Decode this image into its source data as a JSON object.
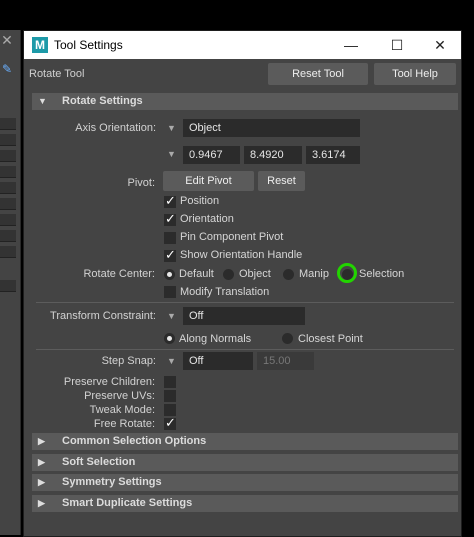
{
  "window": {
    "title": "Tool Settings",
    "app_icon_letter": "M",
    "min_glyph": "—",
    "max_glyph": "☐",
    "close_glyph": "✕"
  },
  "left_strip": {
    "close_glyph": "✕",
    "edit_glyph": "✎"
  },
  "toolbar": {
    "tool_name": "Rotate Tool",
    "reset_tool_label": "Reset Tool",
    "tool_help_label": "Tool Help"
  },
  "rotate_settings": {
    "header": "Rotate Settings",
    "axis_orientation": {
      "label": "Axis Orientation:",
      "value": "Object"
    },
    "axis_values": [
      "0.9467",
      "8.4920",
      "3.6174"
    ],
    "pivot": {
      "label": "Pivot:",
      "edit_label": "Edit Pivot",
      "reset_label": "Reset"
    },
    "checkboxes": [
      {
        "label": "Position",
        "checked": true
      },
      {
        "label": "Orientation",
        "checked": true
      },
      {
        "label": "Pin Component Pivot",
        "checked": false
      },
      {
        "label": "Show Orientation Handle",
        "checked": true
      }
    ],
    "rotate_center": {
      "label": "Rotate Center:",
      "options": [
        "Default",
        "Object",
        "Manip",
        "Selection"
      ],
      "selected": "Default"
    },
    "modify_translation": {
      "label": "Modify Translation",
      "checked": false
    },
    "transform_constraint": {
      "label": "Transform Constraint:",
      "value": "Off"
    },
    "constraint_options": {
      "along_normals": "Along Normals",
      "closest_point": "Closest Point",
      "selected": "Along Normals"
    },
    "step_snap": {
      "label": "Step Snap:",
      "value": "Off",
      "amount": "15.00"
    },
    "flags": [
      {
        "label": "Preserve Children:",
        "checked": false
      },
      {
        "label": "Preserve UVs:",
        "checked": false
      },
      {
        "label": "Tweak Mode:",
        "checked": false
      },
      {
        "label": "Free Rotate:",
        "checked": true
      }
    ]
  },
  "collapsed_sections": [
    "Common Selection Options",
    "Soft Selection",
    "Symmetry Settings",
    "Smart Duplicate Settings"
  ],
  "colors": {
    "panel": "#444444",
    "section": "#5a5a5a",
    "field": "#2b2b2b",
    "highlight": "#22d400"
  }
}
